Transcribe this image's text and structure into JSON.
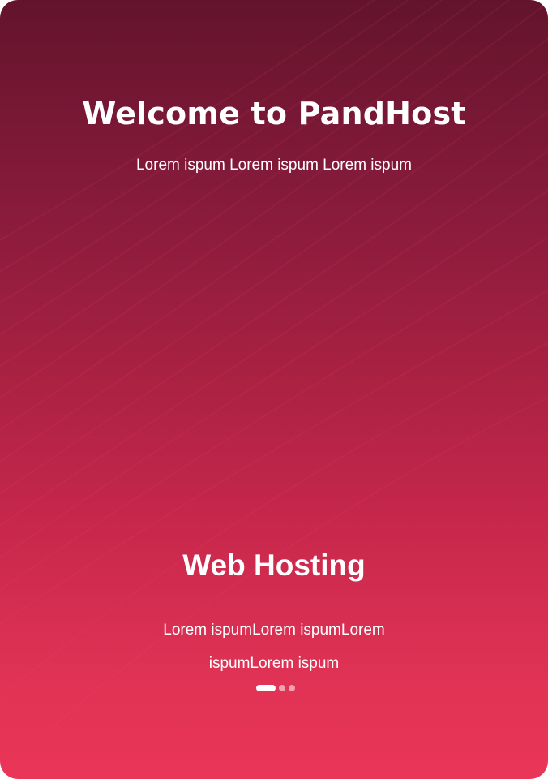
{
  "welcome": {
    "title": "Welcome to PandHost",
    "subtitle": "Lorem ispum Lorem ispum Lorem ispum"
  },
  "slide": {
    "title": "Web Hosting",
    "description": "Lorem ispumLorem ispumLorem ispumLorem ispum"
  },
  "pagination": {
    "total": 3,
    "active_index": 0
  },
  "colors": {
    "gradient_top": "#63142c",
    "gradient_bottom": "#e93558",
    "text": "#ffffff"
  }
}
